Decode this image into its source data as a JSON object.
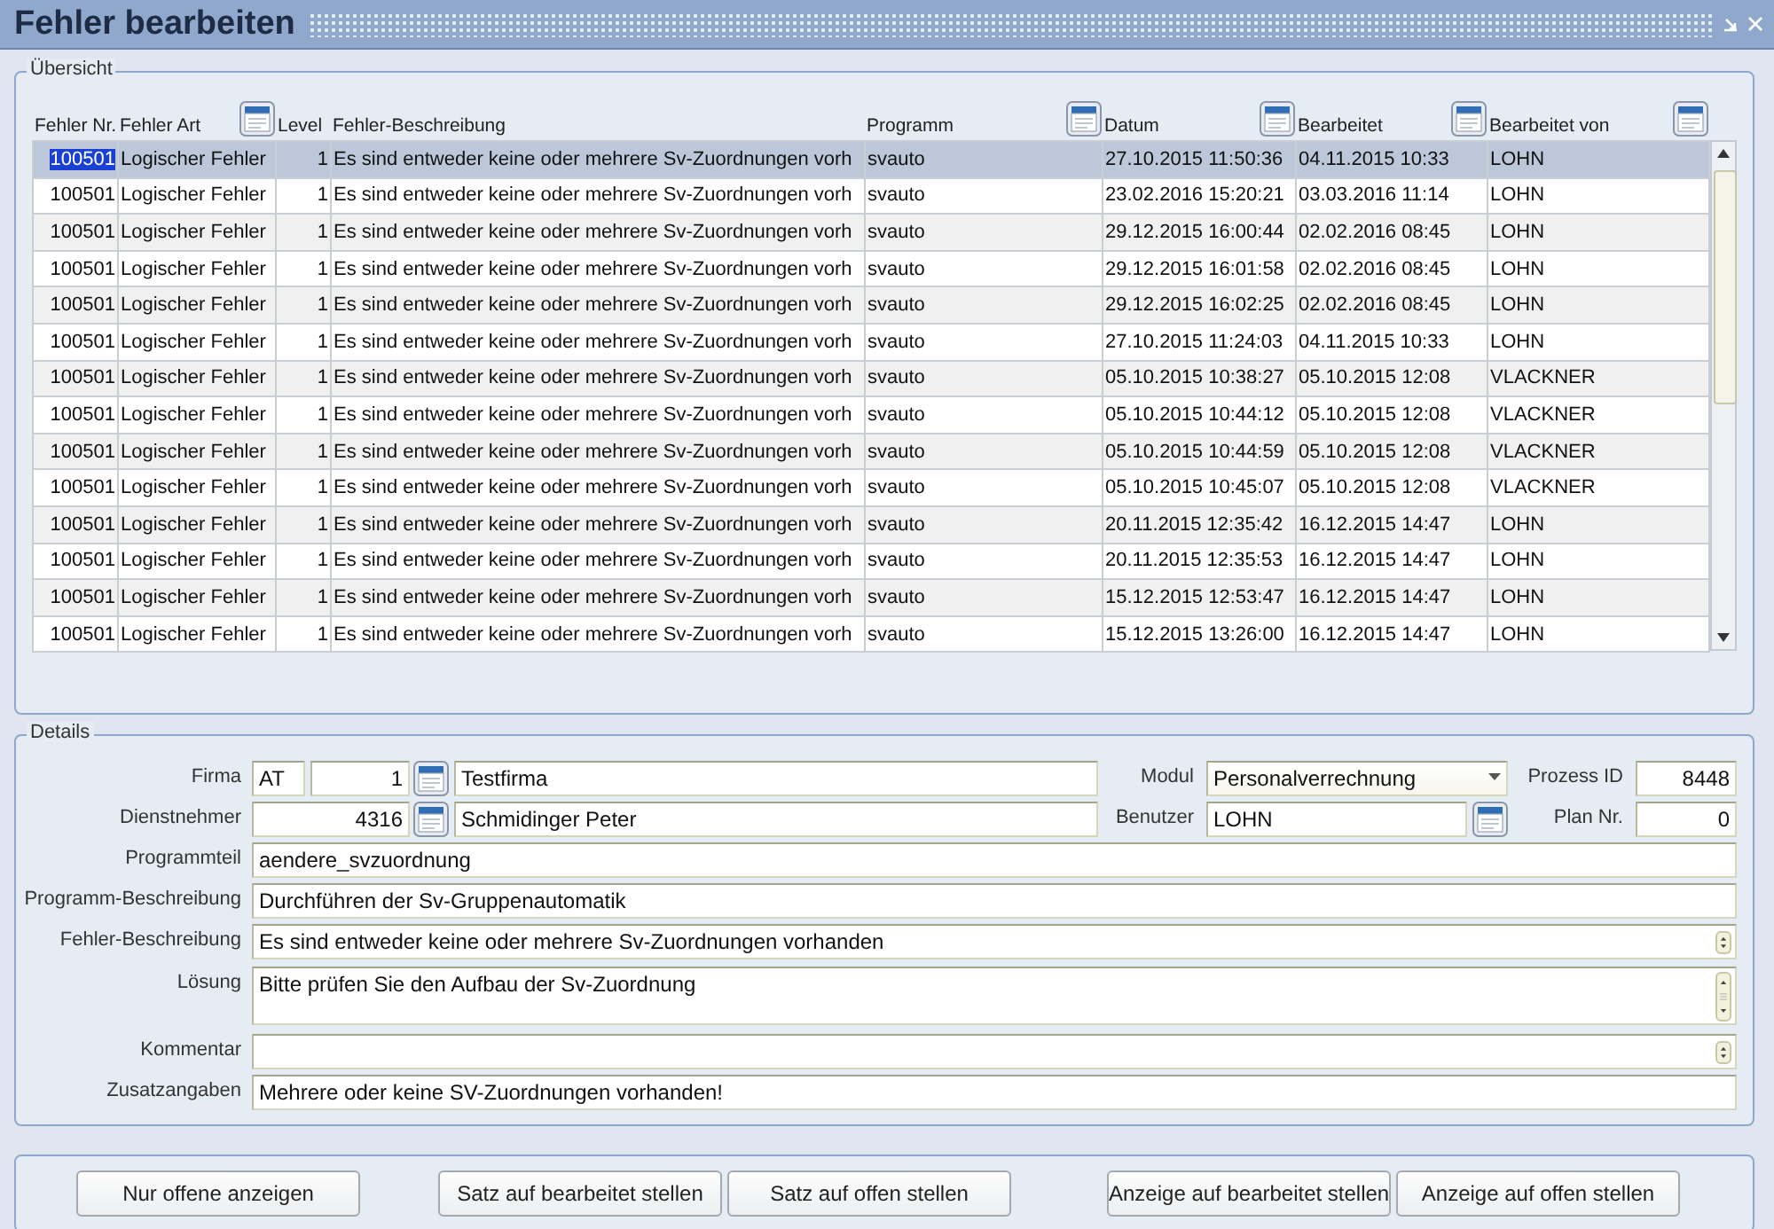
{
  "window": {
    "title": "Fehler bearbeiten"
  },
  "overview": {
    "title": "Übersicht",
    "columns": [
      {
        "label": "Fehler Nr.",
        "lookup": false
      },
      {
        "label": "Fehler Art",
        "lookup": true
      },
      {
        "label": "Level",
        "lookup": false
      },
      {
        "label": "Fehler-Beschreibung",
        "lookup": false
      },
      {
        "label": "Programm",
        "lookup": true
      },
      {
        "label": "Datum",
        "lookup": true
      },
      {
        "label": "Bearbeitet",
        "lookup": true
      },
      {
        "label": "Bearbeitet von",
        "lookup": true
      }
    ],
    "rows": [
      {
        "selected": true,
        "cells": [
          "100501",
          "Logischer Fehler",
          "1",
          "Es sind entweder keine oder mehrere Sv-Zuordnungen vorh",
          "svauto",
          "27.10.2015 11:50:36",
          "04.11.2015 10:33",
          "LOHN"
        ]
      },
      {
        "selected": false,
        "cells": [
          "100501",
          "Logischer Fehler",
          "1",
          "Es sind entweder keine oder mehrere Sv-Zuordnungen vorh",
          "svauto",
          "23.02.2016 15:20:21",
          "03.03.2016 11:14",
          "LOHN"
        ]
      },
      {
        "selected": false,
        "cells": [
          "100501",
          "Logischer Fehler",
          "1",
          "Es sind entweder keine oder mehrere Sv-Zuordnungen vorh",
          "svauto",
          "29.12.2015 16:00:44",
          "02.02.2016 08:45",
          "LOHN"
        ]
      },
      {
        "selected": false,
        "cells": [
          "100501",
          "Logischer Fehler",
          "1",
          "Es sind entweder keine oder mehrere Sv-Zuordnungen vorh",
          "svauto",
          "29.12.2015 16:01:58",
          "02.02.2016 08:45",
          "LOHN"
        ]
      },
      {
        "selected": false,
        "cells": [
          "100501",
          "Logischer Fehler",
          "1",
          "Es sind entweder keine oder mehrere Sv-Zuordnungen vorh",
          "svauto",
          "29.12.2015 16:02:25",
          "02.02.2016 08:45",
          "LOHN"
        ]
      },
      {
        "selected": false,
        "cells": [
          "100501",
          "Logischer Fehler",
          "1",
          "Es sind entweder keine oder mehrere Sv-Zuordnungen vorh",
          "svauto",
          "27.10.2015 11:24:03",
          "04.11.2015 10:33",
          "LOHN"
        ]
      },
      {
        "selected": false,
        "cells": [
          "100501",
          "Logischer Fehler",
          "1",
          "Es sind entweder keine oder mehrere Sv-Zuordnungen vorh",
          "svauto",
          "05.10.2015 10:38:27",
          "05.10.2015 12:08",
          "VLACKNER"
        ]
      },
      {
        "selected": false,
        "cells": [
          "100501",
          "Logischer Fehler",
          "1",
          "Es sind entweder keine oder mehrere Sv-Zuordnungen vorh",
          "svauto",
          "05.10.2015 10:44:12",
          "05.10.2015 12:08",
          "VLACKNER"
        ]
      },
      {
        "selected": false,
        "cells": [
          "100501",
          "Logischer Fehler",
          "1",
          "Es sind entweder keine oder mehrere Sv-Zuordnungen vorh",
          "svauto",
          "05.10.2015 10:44:59",
          "05.10.2015 12:08",
          "VLACKNER"
        ]
      },
      {
        "selected": false,
        "cells": [
          "100501",
          "Logischer Fehler",
          "1",
          "Es sind entweder keine oder mehrere Sv-Zuordnungen vorh",
          "svauto",
          "05.10.2015 10:45:07",
          "05.10.2015 12:08",
          "VLACKNER"
        ]
      },
      {
        "selected": false,
        "cells": [
          "100501",
          "Logischer Fehler",
          "1",
          "Es sind entweder keine oder mehrere Sv-Zuordnungen vorh",
          "svauto",
          "20.11.2015 12:35:42",
          "16.12.2015 14:47",
          "LOHN"
        ]
      },
      {
        "selected": false,
        "cells": [
          "100501",
          "Logischer Fehler",
          "1",
          "Es sind entweder keine oder mehrere Sv-Zuordnungen vorh",
          "svauto",
          "20.11.2015 12:35:53",
          "16.12.2015 14:47",
          "LOHN"
        ]
      },
      {
        "selected": false,
        "cells": [
          "100501",
          "Logischer Fehler",
          "1",
          "Es sind entweder keine oder mehrere Sv-Zuordnungen vorh",
          "svauto",
          "15.12.2015 12:53:47",
          "16.12.2015 14:47",
          "LOHN"
        ]
      },
      {
        "selected": false,
        "cells": [
          "100501",
          "Logischer Fehler",
          "1",
          "Es sind entweder keine oder mehrere Sv-Zuordnungen vorh",
          "svauto",
          "15.12.2015 13:26:00",
          "16.12.2015 14:47",
          "LOHN"
        ]
      }
    ]
  },
  "details": {
    "title": "Details",
    "firma": {
      "label": "Firma",
      "code": "AT",
      "number": "1",
      "name": "Testfirma"
    },
    "modul": {
      "label": "Modul",
      "value": "Personalverrechnung"
    },
    "prozess_id": {
      "label": "Prozess ID",
      "value": "8448"
    },
    "dienstnehmer": {
      "label": "Dienstnehmer",
      "number": "4316",
      "name": "Schmidinger Peter"
    },
    "benutzer": {
      "label": "Benutzer",
      "value": "LOHN"
    },
    "plan_nr": {
      "label": "Plan Nr.",
      "value": "0"
    },
    "text_fields": [
      {
        "kind": "line",
        "label": "Programmteil",
        "value": "aendere_svzuordnung"
      },
      {
        "kind": "line",
        "label": "Programm-Beschreibung",
        "value": "Durchführen der Sv-Gruppenautomatik"
      },
      {
        "kind": "spin",
        "label": "Fehler-Beschreibung",
        "value": "Es sind entweder keine oder mehrere Sv-Zuordnungen vorhanden"
      },
      {
        "kind": "area",
        "label": "Lösung",
        "value": "Bitte prüfen Sie den Aufbau der Sv-Zuordnung"
      },
      {
        "kind": "spin",
        "label": "Kommentar"
      },
      {
        "kind": "line",
        "label": "Zusatzangaben",
        "value": "Mehrere oder keine SV-Zuordnungen vorhanden!"
      }
    ]
  },
  "button_groups": [
    [
      "Nur offene anzeigen"
    ],
    [
      "Satz auf bearbeitet stellen",
      "Satz auf offen stellen"
    ],
    [
      "Anzeige auf bearbeitet stellen",
      "Anzeige auf offen stellen"
    ]
  ]
}
